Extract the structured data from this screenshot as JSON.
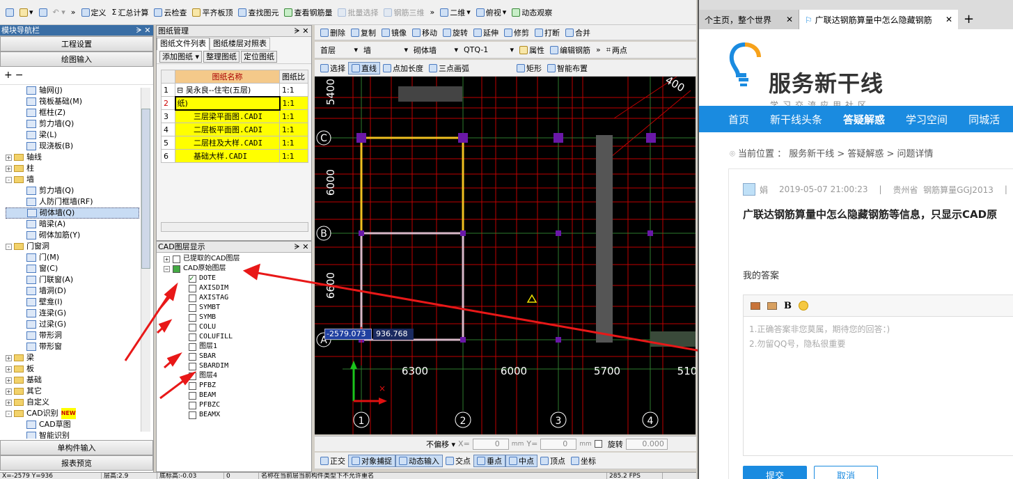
{
  "app": {
    "main_toolbar": [
      "定义",
      "汇总计算",
      "云检查",
      "平齐板顶",
      "查找图元",
      "查看钢筋量",
      "批量选择",
      "钢筋三维",
      "二维",
      "俯视",
      "动态观察"
    ],
    "module_nav": {
      "title": "模块导航栏",
      "btn_project": "工程设置",
      "btn_draw": "绘图输入",
      "btn_single": "单构件输入",
      "btn_report": "报表预览",
      "tree": [
        {
          "label": "轴网(J)",
          "level": 2
        },
        {
          "label": "筏板基础(M)",
          "level": 2
        },
        {
          "label": "框柱(Z)",
          "level": 2
        },
        {
          "label": "剪力墙(Q)",
          "level": 2
        },
        {
          "label": "梁(L)",
          "level": 2
        },
        {
          "label": "现浇板(B)",
          "level": 2
        },
        {
          "label": "轴线",
          "level": 0,
          "toggle": "+"
        },
        {
          "label": "柱",
          "level": 0,
          "toggle": "+"
        },
        {
          "label": "墙",
          "level": 0,
          "toggle": "-"
        },
        {
          "label": "剪力墙(Q)",
          "level": 2
        },
        {
          "label": "人防门框墙(RF)",
          "level": 2
        },
        {
          "label": "砌体墙(Q)",
          "level": 2,
          "selected": true
        },
        {
          "label": "暗梁(A)",
          "level": 2
        },
        {
          "label": "砌体加筋(Y)",
          "level": 2
        },
        {
          "label": "门窗洞",
          "level": 0,
          "toggle": "-"
        },
        {
          "label": "门(M)",
          "level": 2
        },
        {
          "label": "窗(C)",
          "level": 2
        },
        {
          "label": "门联窗(A)",
          "level": 2
        },
        {
          "label": "墙洞(D)",
          "level": 2
        },
        {
          "label": "壁龛(I)",
          "level": 2
        },
        {
          "label": "连梁(G)",
          "level": 2
        },
        {
          "label": "过梁(G)",
          "level": 2
        },
        {
          "label": "带形洞",
          "level": 2
        },
        {
          "label": "带形窗",
          "level": 2
        },
        {
          "label": "梁",
          "level": 0,
          "toggle": "+"
        },
        {
          "label": "板",
          "level": 0,
          "toggle": "+"
        },
        {
          "label": "基础",
          "level": 0,
          "toggle": "+"
        },
        {
          "label": "其它",
          "level": 0,
          "toggle": "+"
        },
        {
          "label": "自定义",
          "level": 0,
          "toggle": "+"
        },
        {
          "label": "CAD识别",
          "level": 0,
          "toggle": "-",
          "badge": "NEW"
        },
        {
          "label": "CAD草图",
          "level": 2
        },
        {
          "label": "智能识别",
          "level": 2
        }
      ]
    },
    "drawing_mgmt": {
      "title": "图纸管理",
      "tab1": "图纸文件列表",
      "tab2": "图纸楼层对照表",
      "btns": [
        "添加图纸",
        "整理图纸",
        "定位图纸"
      ],
      "col_name": "图纸名称",
      "col_ratio": "图纸比",
      "rows": [
        {
          "n": "1",
          "name": "吴永良--住宅(五层)",
          "ratio": "1:1"
        },
        {
          "n": "2",
          "name": "纸)",
          "ratio": "1:1"
        },
        {
          "n": "3",
          "name": "三层梁平面图.CADI",
          "ratio": "1:1"
        },
        {
          "n": "4",
          "name": "二层板平面图.CADI",
          "ratio": "1:1"
        },
        {
          "n": "5",
          "name": "二层柱及大样.CADI",
          "ratio": "1:1"
        },
        {
          "n": "6",
          "name": "基础大样.CADI",
          "ratio": "1:1"
        }
      ]
    },
    "cad_layers": {
      "title": "CAD图层显示",
      "extracted": "已提取的CAD图层",
      "original": "CAD原始图层",
      "layers": [
        {
          "name": "DOTE",
          "checked": true
        },
        {
          "name": "AXISDIM",
          "checked": false
        },
        {
          "name": "AXISTAG",
          "checked": false
        },
        {
          "name": "SYMBT",
          "checked": false
        },
        {
          "name": "SYMB",
          "checked": false
        },
        {
          "name": "COLU",
          "checked": false
        },
        {
          "name": "COLUFILL",
          "checked": false
        },
        {
          "name": "图层1",
          "checked": false
        },
        {
          "name": "SBAR",
          "checked": false
        },
        {
          "name": "SBARDIM",
          "checked": false
        },
        {
          "name": "图层4",
          "checked": false
        },
        {
          "name": "PFBZ",
          "checked": false
        },
        {
          "name": "BEAM",
          "checked": false
        },
        {
          "name": "PFBZC",
          "checked": false
        },
        {
          "name": "BEAMX",
          "checked": false
        }
      ]
    },
    "edit_toolbar": [
      "删除",
      "复制",
      "镜像",
      "移动",
      "旋转",
      "延伸",
      "修剪",
      "打断",
      "合并"
    ],
    "prop_toolbar": {
      "floor": "首层",
      "type": "墙",
      "subtype": "砌体墙",
      "name": "QTQ-1",
      "attr": "属性",
      "edit": "编辑钢筋",
      "twopt": "两点"
    },
    "draw_toolbar": [
      "选择",
      "直线",
      "点加长度",
      "三点画弧",
      "矩形",
      "智能布置"
    ],
    "canvas": {
      "axis_rows": [
        "C",
        "B",
        "A"
      ],
      "axis_cols": [
        "1",
        "2",
        "3",
        "4"
      ],
      "dims_bottom": [
        "6300",
        "6000",
        "5700",
        "510"
      ],
      "dims_left": [
        "5400",
        "6000",
        "6600"
      ],
      "corner_dim": "400",
      "coord_x": "-2579.073",
      "coord_y": "936.768"
    },
    "status_toolbar": {
      "offset": "不偏移",
      "xlabel": "X=",
      "xval": "0",
      "ylabel": "Y=",
      "yval": "0",
      "unit": "mm",
      "rotate": "旋转",
      "rotval": "0.000"
    },
    "snap_toolbar": [
      "正交",
      "对象捕捉",
      "动态输入",
      "交点",
      "垂点",
      "中点",
      "顶点",
      "坐标"
    ],
    "statusbar": [
      "X=-2579 Y=936",
      "层高:2.9",
      "底标高:-0.03",
      "0",
      "名称在当前层当前构件类型下不允许重名",
      "285.2 FPS"
    ]
  },
  "browser": {
    "tab1": "个主页，整个世界",
    "tab2": "广联达钢筋算量中怎么隐藏钢筋",
    "logo_title": "服务新干线",
    "logo_sub": "学习交流应用社区",
    "nav": [
      "首页",
      "新干线头条",
      "答疑解惑",
      "学习空间",
      "同城活"
    ],
    "breadcrumb_prefix": "当前位置 ：",
    "breadcrumb": "服务新干线 > 答疑解惑 > 问题详情",
    "author": "娟",
    "date": "2019-05-07 21:00:23",
    "region": "贵州省",
    "category": "钢筋算量GGJ2013",
    "question": "广联达钢筋算量中怎么隐藏钢筋等信息，只显示CAD原",
    "answer_label": "我的答案",
    "placeholder_line1": "1.正确答案非您莫属，期待您的回答：)",
    "placeholder_line2": "2.勿留QQ号，隐私很重要",
    "submit": "提交",
    "cancel": "取消",
    "colors": {
      "nav_bg": "#1a8be0",
      "accent": "#0a72c8"
    }
  }
}
